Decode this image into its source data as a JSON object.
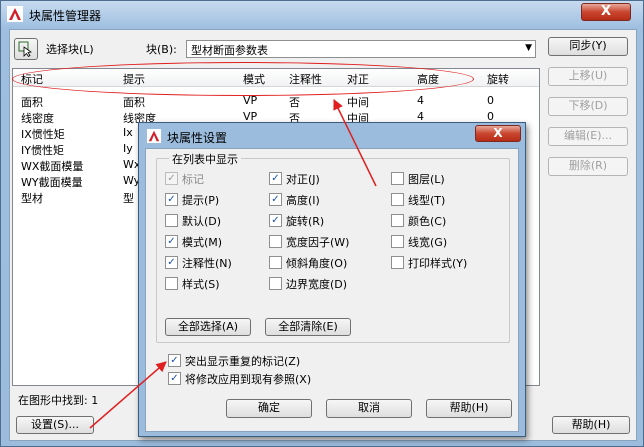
{
  "window": {
    "title": "块属性管理器",
    "close_label": "X"
  },
  "toolbar": {
    "select_block_label": "选择块(L)",
    "block_label": "块(B):",
    "block_value": "型材断面参数表"
  },
  "list": {
    "headers": [
      "标记",
      "提示",
      "模式",
      "注释性",
      "对正",
      "高度",
      "旋转"
    ],
    "rows": [
      [
        "面积",
        "面积",
        "VP",
        "否",
        "中间",
        "4",
        "0"
      ],
      [
        "线密度",
        "线密度",
        "VP",
        "否",
        "中间",
        "4",
        "0"
      ],
      [
        "IX惯性矩",
        "Ix",
        "",
        "",
        "",
        "",
        ""
      ],
      [
        "IY惯性矩",
        "Iy",
        "",
        "",
        "",
        "",
        ""
      ],
      [
        "WX截面模量",
        "Wx",
        "",
        "",
        "",
        "",
        ""
      ],
      [
        "WY截面模量",
        "Wy",
        "",
        "",
        "",
        "",
        ""
      ],
      [
        "型材",
        "型",
        "",
        "",
        "",
        "",
        ""
      ]
    ]
  },
  "side_buttons": {
    "sync": "同步(Y)",
    "move_up": "上移(U)",
    "move_down": "下移(D)",
    "edit": "编辑(E)...",
    "delete": "删除(R)"
  },
  "status": {
    "found_label": "在图形中找到: 1"
  },
  "bottom_buttons": {
    "settings": "设置(S)...",
    "help": "帮助(H)"
  },
  "dialog": {
    "title": "块属性设置",
    "close_label": "X",
    "group_title": "在列表中显示",
    "options": [
      {
        "label": "标记",
        "checked": true,
        "disabled": true
      },
      {
        "label": "对正(J)",
        "checked": true,
        "disabled": false
      },
      {
        "label": "图层(L)",
        "checked": false,
        "disabled": false
      },
      {
        "label": "提示(P)",
        "checked": true,
        "disabled": false
      },
      {
        "label": "高度(I)",
        "checked": true,
        "disabled": false
      },
      {
        "label": "线型(T)",
        "checked": false,
        "disabled": false
      },
      {
        "label": "默认(D)",
        "checked": false,
        "disabled": false
      },
      {
        "label": "旋转(R)",
        "checked": true,
        "disabled": false
      },
      {
        "label": "颜色(C)",
        "checked": false,
        "disabled": false
      },
      {
        "label": "模式(M)",
        "checked": true,
        "disabled": false
      },
      {
        "label": "宽度因子(W)",
        "checked": false,
        "disabled": false
      },
      {
        "label": "线宽(G)",
        "checked": false,
        "disabled": false
      },
      {
        "label": "注释性(N)",
        "checked": true,
        "disabled": false
      },
      {
        "label": "倾斜角度(O)",
        "checked": false,
        "disabled": false
      },
      {
        "label": "打印样式(Y)",
        "checked": false,
        "disabled": false
      },
      {
        "label": "样式(S)",
        "checked": false,
        "disabled": false
      },
      {
        "label": "边界宽度(D)",
        "checked": false,
        "disabled": false
      }
    ],
    "select_all": "全部选择(A)",
    "clear_all": "全部清除(E)",
    "highlight_duplicates": "突出显示重复的标记(Z)",
    "highlight_duplicates_checked": true,
    "apply_existing": "将修改应用到现有参照(X)",
    "apply_existing_checked": true,
    "ok": "确定",
    "cancel": "取消",
    "help": "帮助(H)"
  },
  "colors": {
    "annotation": "#e02020",
    "title_bar": "#9cbcdd",
    "check_mark": "#1c4fa8"
  }
}
